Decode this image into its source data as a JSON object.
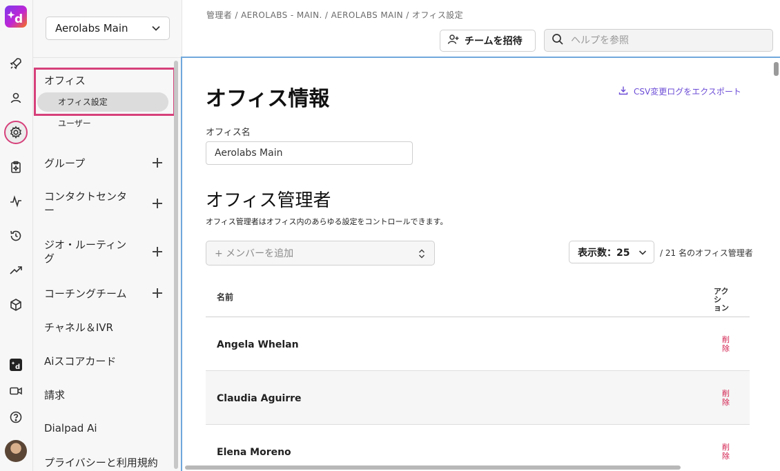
{
  "workspace": {
    "name": "Aerolabs Main"
  },
  "breadcrumb": "管理者 / AEROLABS - MAIN. / AEROLABS MAIN / オフィス設定",
  "header": {
    "invite_label": "チームを招待",
    "search_placeholder": "ヘルプを参照"
  },
  "nav": {
    "office": "オフィス",
    "office_settings": "オフィス設定",
    "users": "ユーザー",
    "group": "グループ",
    "contact_center_l1": "コンタクトセンタ",
    "contact_center_l2": "ー",
    "geo_routing_l1": "ジオ・ルーティン",
    "geo_routing_l2": "グ",
    "coaching": "コーチングチーム",
    "channels": "チャネル＆IVR",
    "scorecard": "Aiスコアカード",
    "billing": "請求",
    "dialpad_ai": "Dialpad Ai",
    "privacy": "プライバシーと利用規約"
  },
  "main": {
    "title": "オフィス情報",
    "export_label": "CSV変更ログをエクスポート",
    "office_name_label": "オフィス名",
    "office_name_value": "Aerolabs Main",
    "admins_title": "オフィス管理者",
    "admins_desc": "オフィス管理者はオフィス内のあらゆる設定をコントロールできます。",
    "add_member_placeholder": "+ メンバーを追加",
    "per_page_label": "表示数：25",
    "count_label": "/ 21 名のオフィス管理者",
    "col_name": "名前",
    "col_action_l1": "アクシ",
    "col_action_l2": "ョン",
    "delete_l1": "削",
    "delete_l2": "除",
    "rows": [
      {
        "name": "Angela Whelan"
      },
      {
        "name": "Claudia Aguirre"
      },
      {
        "name": "Elena Moreno"
      }
    ]
  },
  "colors": {
    "accent": "#6c4cd6",
    "highlight": "#d6407a",
    "danger": "#d11a4a"
  }
}
